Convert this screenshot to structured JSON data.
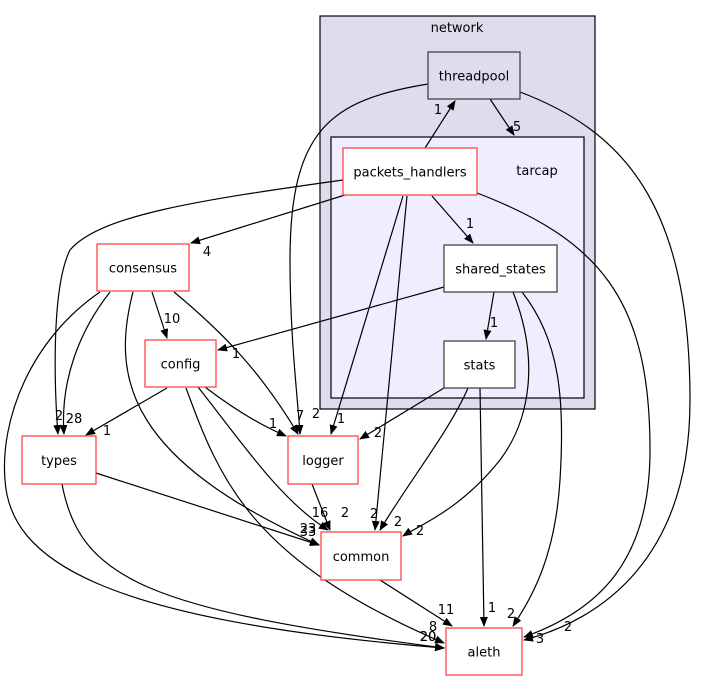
{
  "clusters": [
    {
      "id": "network",
      "label": "network",
      "fill": "#ddddee"
    },
    {
      "id": "tarcap",
      "label": "tarcap",
      "fill": "#eeeeff"
    }
  ],
  "nodes": [
    {
      "id": "threadpool",
      "label": "threadpool",
      "border": "#444444",
      "fill": "#ddddee"
    },
    {
      "id": "packets_handlers",
      "label": "packets_handlers",
      "border": "#ff4444",
      "fill": "#ffffff"
    },
    {
      "id": "shared_states",
      "label": "shared_states",
      "border": "#444444",
      "fill": "#ffffff"
    },
    {
      "id": "stats",
      "label": "stats",
      "border": "#444444",
      "fill": "#ffffff"
    },
    {
      "id": "consensus",
      "label": "consensus",
      "border": "#ff4444",
      "fill": "#ffffff"
    },
    {
      "id": "config",
      "label": "config",
      "border": "#ff4444",
      "fill": "#ffffff"
    },
    {
      "id": "types",
      "label": "types",
      "border": "#ff4444",
      "fill": "#ffffff"
    },
    {
      "id": "logger",
      "label": "logger",
      "border": "#ff4444",
      "fill": "#ffffff"
    },
    {
      "id": "common",
      "label": "common",
      "border": "#ff4444",
      "fill": "#ffffff"
    },
    {
      "id": "aleth",
      "label": "aleth",
      "border": "#ff4444",
      "fill": "#ffffff"
    }
  ],
  "edges": [
    {
      "from": "packets_handlers",
      "to": "threadpool",
      "label": "1"
    },
    {
      "from": "threadpool",
      "to": "tarcap",
      "label": "5"
    },
    {
      "from": "threadpool",
      "to": "logger",
      "label": "2"
    },
    {
      "from": "threadpool",
      "to": "aleth",
      "label": "3"
    },
    {
      "from": "packets_handlers",
      "to": "consensus",
      "label": "4"
    },
    {
      "from": "packets_handlers",
      "to": "types",
      "label": "2"
    },
    {
      "from": "packets_handlers",
      "to": "shared_states",
      "label": "1"
    },
    {
      "from": "packets_handlers",
      "to": "logger",
      "label": "1"
    },
    {
      "from": "packets_handlers",
      "to": "common",
      "label": "2"
    },
    {
      "from": "packets_handlers",
      "to": "aleth",
      "label": "2"
    },
    {
      "from": "shared_states",
      "to": "config",
      "label": "1"
    },
    {
      "from": "shared_states",
      "to": "stats",
      "label": "1"
    },
    {
      "from": "shared_states",
      "to": "common",
      "label": "2"
    },
    {
      "from": "shared_states",
      "to": "aleth",
      "label": "2"
    },
    {
      "from": "stats",
      "to": "logger",
      "label": "2"
    },
    {
      "from": "stats",
      "to": "common",
      "label": "2"
    },
    {
      "from": "stats",
      "to": "aleth",
      "label": "1"
    },
    {
      "from": "consensus",
      "to": "config",
      "label": "10"
    },
    {
      "from": "consensus",
      "to": "logger",
      "label": "7"
    },
    {
      "from": "consensus",
      "to": "types",
      "label": "28"
    },
    {
      "from": "consensus",
      "to": "common",
      "label": "23"
    },
    {
      "from": "consensus",
      "to": "aleth",
      "label": "20"
    },
    {
      "from": "config",
      "to": "types",
      "label": "1"
    },
    {
      "from": "config",
      "to": "logger",
      "label": "1"
    },
    {
      "from": "config",
      "to": "common",
      "label": "16"
    },
    {
      "from": "config",
      "to": "aleth",
      "label": "8"
    },
    {
      "from": "types",
      "to": "common",
      "label": "33"
    },
    {
      "from": "types",
      "to": "aleth",
      "label": "20"
    },
    {
      "from": "logger",
      "to": "common",
      "label": "2"
    },
    {
      "from": "common",
      "to": "aleth",
      "label": "11"
    }
  ]
}
